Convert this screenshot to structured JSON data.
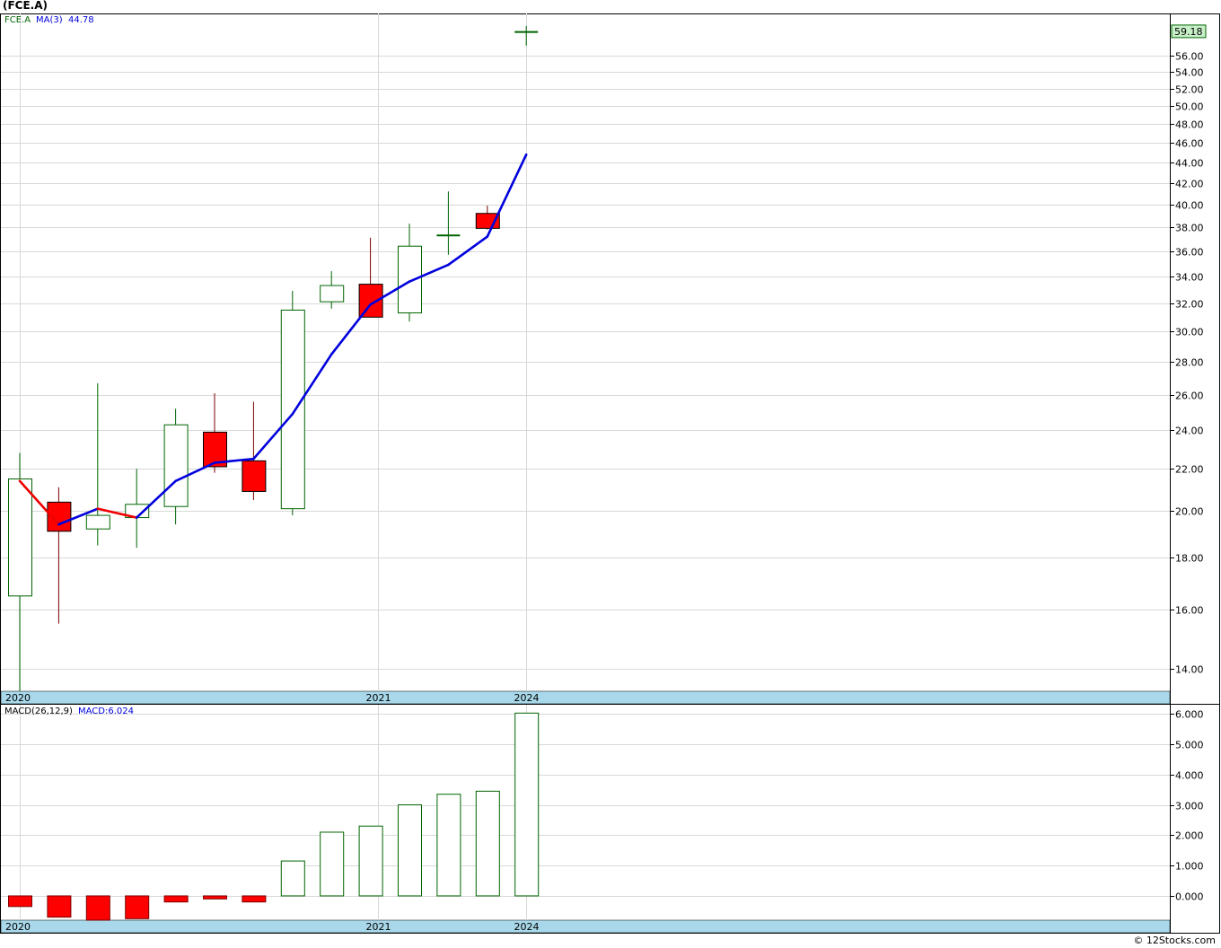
{
  "symbol_title": "(FCE.A)",
  "watermark": "© 12Stocks.com",
  "price_panel": {
    "legend_symbol": "FCE.A",
    "legend_ma_label": "MA(3)",
    "legend_ma_value": "44.78",
    "last_price_label": "59.18"
  },
  "macd_panel": {
    "legend_label": "MACD(26,12,9)",
    "legend_value": "MACD:6.024"
  },
  "colors": {
    "up": "#006400",
    "down_fill": "#ff0000",
    "ma_rising": "#0000dd",
    "ma_falling": "#ee0000",
    "axis_band": "#a8d8ea",
    "grid": "#d8d8d8",
    "last_price_box": "#c8f0c8"
  },
  "chart_data": [
    {
      "type": "candlestick",
      "title": "(FCE.A)",
      "y_scale": "log",
      "ylim": [
        13.3,
        61
      ],
      "x_labels": [
        {
          "label": "2020",
          "at_index": 0
        },
        {
          "label": "2021",
          "at_index": 9.2
        },
        {
          "label": "2024",
          "at_index": 13
        }
      ],
      "y_ticks": [
        14,
        16,
        18,
        20,
        22,
        24,
        26,
        28,
        30,
        32,
        34,
        36,
        38,
        40,
        42,
        44,
        46,
        48,
        50,
        52,
        54,
        56
      ],
      "candles": [
        {
          "o": 16.5,
          "h": 22.8,
          "l": 13.3,
          "c": 21.5
        },
        {
          "o": 20.4,
          "h": 21.1,
          "l": 15.5,
          "c": 19.1
        },
        {
          "o": 19.2,
          "h": 26.7,
          "l": 18.5,
          "c": 19.8
        },
        {
          "o": 19.7,
          "h": 22.0,
          "l": 18.4,
          "c": 20.3
        },
        {
          "o": 20.2,
          "h": 25.2,
          "l": 19.4,
          "c": 24.3
        },
        {
          "o": 23.9,
          "h": 26.1,
          "l": 21.8,
          "c": 22.1
        },
        {
          "o": 22.4,
          "h": 25.6,
          "l": 20.5,
          "c": 20.9
        },
        {
          "o": 20.1,
          "h": 32.9,
          "l": 19.8,
          "c": 31.5
        },
        {
          "o": 32.1,
          "h": 34.4,
          "l": 31.6,
          "c": 33.3
        },
        {
          "o": 33.4,
          "h": 37.1,
          "l": 31.0,
          "c": 31.0
        },
        {
          "o": 31.3,
          "h": 38.3,
          "l": 30.7,
          "c": 36.4
        },
        {
          "o": 37.3,
          "h": 41.2,
          "l": 35.7,
          "c": 37.3
        },
        {
          "o": 39.2,
          "h": 39.9,
          "l": 37.8,
          "c": 37.9
        },
        {
          "o": 59.0,
          "h": 59.9,
          "l": 57.3,
          "c": 59.18
        }
      ],
      "series": [
        {
          "name": "MA(3)",
          "values": [
            21.4,
            19.4,
            20.1,
            19.7,
            21.4,
            22.3,
            22.5,
            24.9,
            28.5,
            31.9,
            33.6,
            34.9,
            37.2,
            44.78
          ]
        }
      ]
    },
    {
      "type": "bar",
      "title": "MACD(26,12,9)",
      "ylim": [
        -0.8,
        6.3
      ],
      "x_labels": [
        {
          "label": "2020",
          "at_index": 0
        },
        {
          "label": "2021",
          "at_index": 9.2
        },
        {
          "label": "2024",
          "at_index": 13
        }
      ],
      "y_ticks": [
        0,
        1,
        2,
        3,
        4,
        5,
        6
      ],
      "y_tick_labels": [
        "0.000",
        "1.000",
        "2.000",
        "3.000",
        "4.000",
        "5.000",
        "6.000"
      ],
      "series": [
        {
          "name": "MACD",
          "values": [
            -0.35,
            -0.7,
            -0.8,
            -0.75,
            -0.2,
            -0.1,
            -0.2,
            1.15,
            2.1,
            2.3,
            3.0,
            3.35,
            3.45,
            6.024
          ]
        }
      ]
    }
  ]
}
